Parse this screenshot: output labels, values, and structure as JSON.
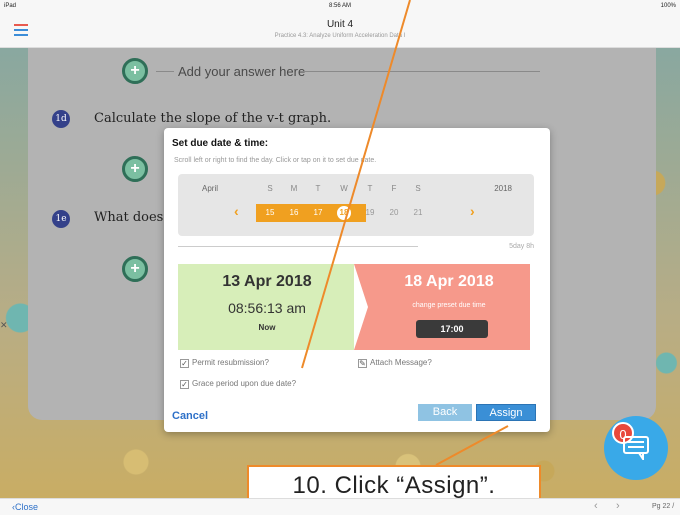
{
  "status_bar": {
    "device": "iPad",
    "time": "8:56 AM",
    "battery": "100%"
  },
  "header": {
    "title": "Unit 4",
    "subtitle": "Practice 4.3: Analyze Uniform Acceleration Data I"
  },
  "content": {
    "add_answer_label": "Add your answer here",
    "questions": [
      {
        "badge": "1d",
        "text": "Calculate the slope of the v-t graph."
      },
      {
        "badge": "1e",
        "text": "What does"
      }
    ]
  },
  "dialog": {
    "title": "Set due date & time:",
    "hint": "Scroll left or right to find the day. Click or tap on it to set due date.",
    "calendar": {
      "month": "April",
      "year": "2018",
      "weekdays": [
        "S",
        "M",
        "T",
        "W",
        "T",
        "F",
        "S"
      ],
      "days": [
        "15",
        "16",
        "17",
        "18",
        "19",
        "20",
        "21"
      ],
      "selected_day": "18"
    },
    "duration": "5day 8h",
    "from": {
      "date": "13 Apr 2018",
      "time": "08:56:13 am",
      "label": "Now"
    },
    "to": {
      "date": "18 Apr 2018",
      "preset_label": "change preset due time",
      "time": "17:00"
    },
    "options": {
      "permit_resubmission": "Permit resubmission?",
      "attach_message": "Attach Message?",
      "grace_period": "Grace period upon due date?"
    },
    "cancel_label": "Cancel",
    "back_label": "Back",
    "assign_label": "Assign"
  },
  "annotation": {
    "text": "10. Click “Assign”."
  },
  "chat": {
    "badge_count": "0"
  },
  "bottom_bar": {
    "close_label": "Close",
    "page_label": "Pg 22 /"
  },
  "colors": {
    "accent_orange": "#f0a020",
    "assign_blue": "#3a8fd6",
    "from_green": "#d7eeb9",
    "to_red": "#f6998b"
  }
}
